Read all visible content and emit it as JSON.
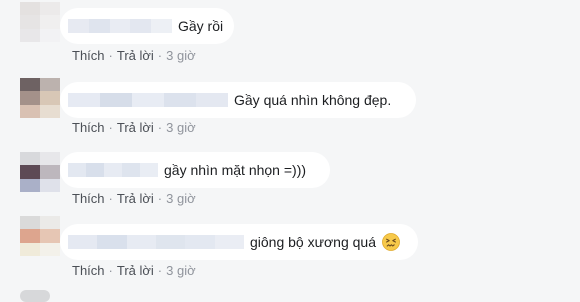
{
  "comments": [
    {
      "text": "Gầy rồi",
      "like": "Thích",
      "reply": "Trả lời",
      "time": "3 giờ",
      "avatar_colors": [
        "#e4e1e0",
        "#eceaea",
        "#e6e4e4",
        "#f0efef",
        "#e8e7e9",
        "#f2f2f4"
      ],
      "name_blur_colors": [
        "#e7eaf2",
        "#dfe4ee",
        "#e9ecf3",
        "#e3e7f0",
        "#edf0f5"
      ]
    },
    {
      "text": "Gầy quá nhìn không đẹp.",
      "like": "Thích",
      "reply": "Trả lời",
      "time": "3 giờ",
      "avatar_colors": [
        "#6e6263",
        "#bcb2ae",
        "#a4918a",
        "#d8c7b6",
        "#d9c1b3",
        "#e7ddd1"
      ],
      "name_blur_colors": [
        "#e6eaf3",
        "#d6dde9",
        "#e8ecf4",
        "#dce2ed",
        "#e4e8f1"
      ]
    },
    {
      "text": "gầy nhìn mặt nhọn =)))",
      "like": "Thích",
      "reply": "Trả lời",
      "time": "3 giờ",
      "avatar_colors": [
        "#d8d9dc",
        "#e7e7ea",
        "#5d4a55",
        "#bdb7bd",
        "#aab0c8",
        "#dfe1ea"
      ],
      "name_blur_colors": [
        "#e3e8f1",
        "#d8dfeb",
        "#e7ebf3",
        "#dee4ee",
        "#e9edf4"
      ]
    },
    {
      "text": "giông bộ xương quá",
      "like": "Thích",
      "reply": "Trả lời",
      "time": "3 giờ",
      "avatar_colors": [
        "#dadada",
        "#ebeae8",
        "#dda58e",
        "#e6c6b4",
        "#f0ebda",
        "#f3f1ea"
      ],
      "name_blur_colors": [
        "#e5e9f2",
        "#d9e0ec",
        "#e7ebf3",
        "#dfe5ee",
        "#e3e8f1",
        "#eaedf4"
      ],
      "emoji": "confounded-face-icon"
    }
  ]
}
